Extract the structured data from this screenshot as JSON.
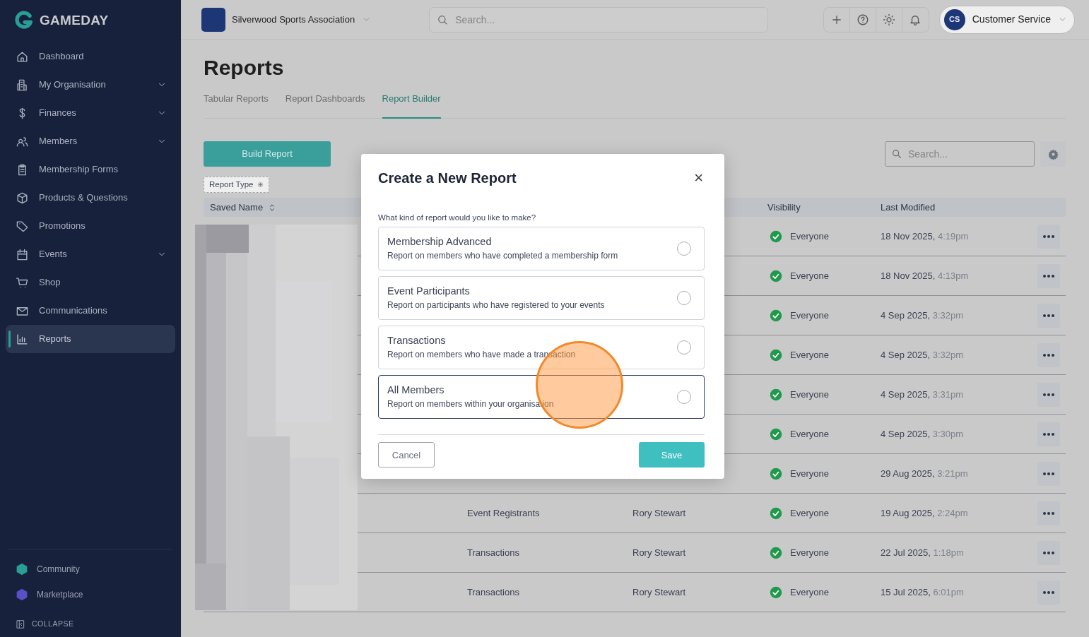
{
  "sidebar": {
    "brand": "GAMEDAY",
    "items": [
      {
        "label": "Dashboard",
        "expandable": false,
        "selected": false
      },
      {
        "label": "My Organisation",
        "expandable": true,
        "selected": false
      },
      {
        "label": "Finances",
        "expandable": true,
        "selected": false
      },
      {
        "label": "Members",
        "expandable": true,
        "selected": false
      },
      {
        "label": "Membership Forms",
        "expandable": false,
        "selected": false
      },
      {
        "label": "Products & Questions",
        "expandable": false,
        "selected": false
      },
      {
        "label": "Promotions",
        "expandable": false,
        "selected": false
      },
      {
        "label": "Events",
        "expandable": true,
        "selected": false
      },
      {
        "label": "Shop",
        "expandable": false,
        "selected": false
      },
      {
        "label": "Communications",
        "expandable": false,
        "selected": false
      },
      {
        "label": "Reports",
        "expandable": false,
        "selected": true
      }
    ],
    "apps": [
      {
        "label": "Community",
        "color": "#2a9d96"
      },
      {
        "label": "Marketplace",
        "color": "#5b4fc4"
      }
    ],
    "collapse": "COLLAPSE"
  },
  "header": {
    "organisation": "Silverwood Sports Association",
    "search": {
      "placeholder": "Search..."
    },
    "user": {
      "initials": "CS",
      "name": "Customer Service"
    }
  },
  "page": {
    "title": "Reports",
    "tabs": [
      {
        "label": "Tabular Reports",
        "selected": false
      },
      {
        "label": "Report Dashboards",
        "selected": false
      },
      {
        "label": "Report Builder",
        "selected": true
      }
    ],
    "build_button": "Build Report",
    "filter_chip": "Report Type",
    "search": {
      "placeholder": "Search..."
    }
  },
  "table": {
    "columns": [
      "Saved Name",
      "Visibility",
      "Last Modified"
    ],
    "rows": [
      {
        "visibility": "Everyone",
        "date": "18 Nov 2025,",
        "time": "4:19pm"
      },
      {
        "visibility": "Everyone",
        "date": "18 Nov 2025,",
        "time": "4:13pm"
      },
      {
        "visibility": "Everyone",
        "date": "4 Sep 2025,",
        "time": "3:32pm"
      },
      {
        "visibility": "Everyone",
        "date": "4 Sep 2025,",
        "time": "3:32pm"
      },
      {
        "visibility": "Everyone",
        "date": "4 Sep 2025,",
        "time": "3:31pm"
      },
      {
        "visibility": "Everyone",
        "date": "4 Sep 2025,",
        "time": "3:30pm"
      },
      {
        "visibility": "Everyone",
        "date": "29 Aug 2025,",
        "time": "3:21pm"
      },
      {
        "type": "Event Registrants",
        "created_by": "Rory Stewart",
        "visibility": "Everyone",
        "date": "19 Aug 2025,",
        "time": "2:24pm"
      },
      {
        "type": "Transactions",
        "created_by": "Rory Stewart",
        "visibility": "Everyone",
        "date": "22 Jul 2025,",
        "time": "1:18pm"
      },
      {
        "type": "Transactions",
        "created_by": "Rory Stewart",
        "visibility": "Everyone",
        "date": "15 Jul 2025,",
        "time": "6:01pm"
      }
    ]
  },
  "modal": {
    "title": "Create a New Report",
    "close": "×",
    "question": "What kind of report would you like to make?",
    "options": [
      {
        "title": "Membership Advanced",
        "description": "Report on members who have completed a membership form",
        "selected": false,
        "focused": false
      },
      {
        "title": "Event Participants",
        "description": "Report on participants who have registered to your events",
        "selected": false,
        "focused": false
      },
      {
        "title": "Transactions",
        "description": "Report on members who have made a transaction",
        "selected": false,
        "focused": false
      },
      {
        "title": "All Members",
        "description": "Report on members within your organisation",
        "selected": false,
        "focused": true
      }
    ],
    "cancel": "Cancel",
    "save": "Save"
  }
}
